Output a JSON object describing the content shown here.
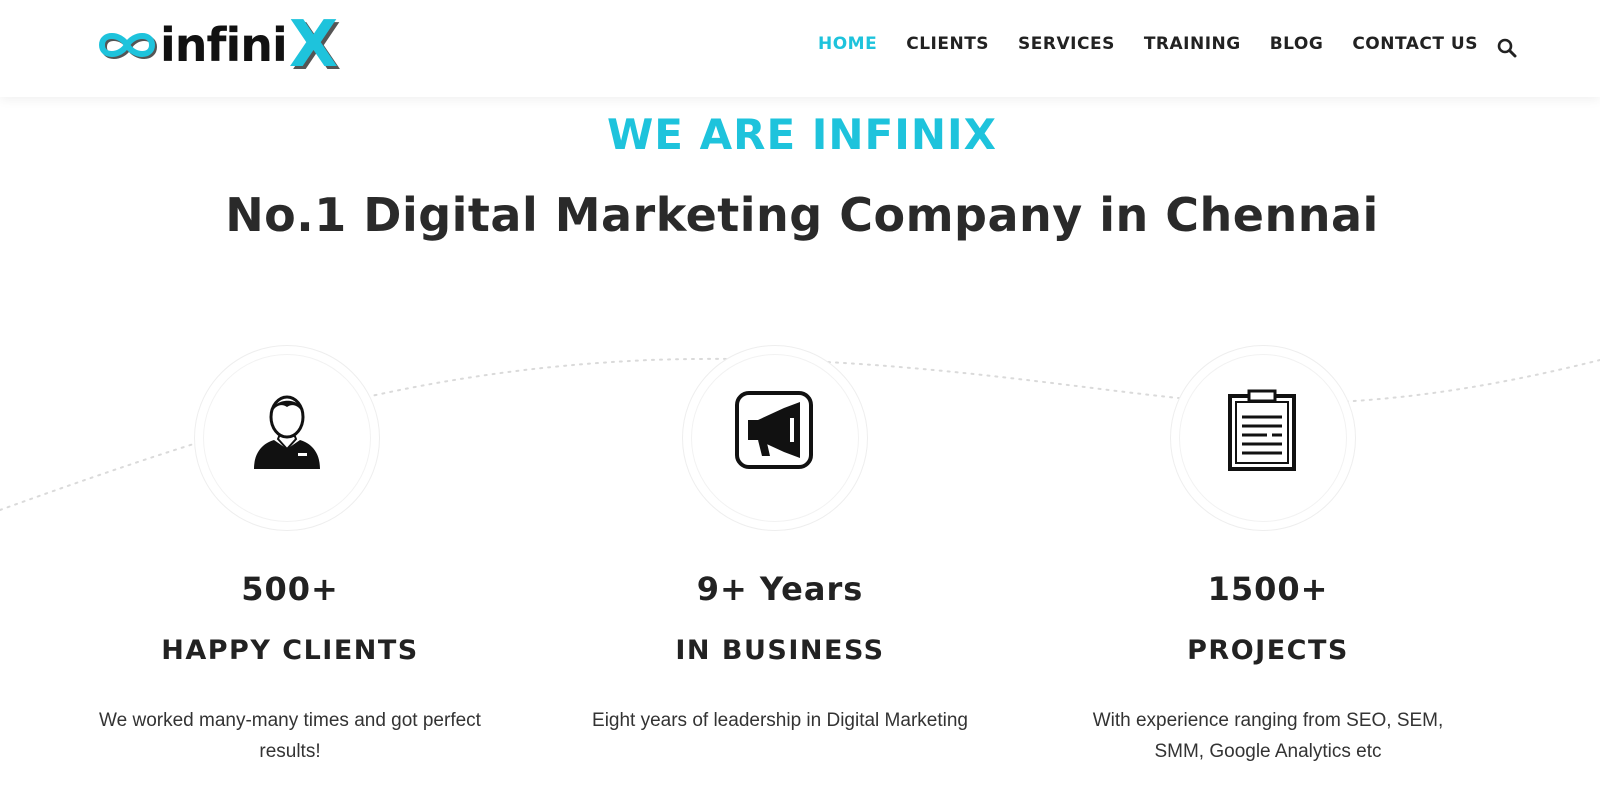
{
  "brand": {
    "logo_text": "infini",
    "logo_x": "X",
    "accent_color": "#1ec3dc"
  },
  "nav": {
    "items": [
      {
        "label": "HOME",
        "active": true
      },
      {
        "label": "CLIENTS"
      },
      {
        "label": "SERVICES"
      },
      {
        "label": "TRAINING"
      },
      {
        "label": "BLOG"
      },
      {
        "label": "CONTACT US"
      }
    ],
    "search_icon": "search-icon"
  },
  "hero": {
    "eyebrow": "WE ARE INFINIX",
    "headline": "No.1 Digital Marketing Company in Chennai"
  },
  "features": [
    {
      "icon": "person-icon",
      "stat": "500+",
      "title": "HAPPY CLIENTS",
      "description": "We worked many-many times and got perfect results!"
    },
    {
      "icon": "megaphone-icon",
      "stat": "9+ Years",
      "title": "IN BUSINESS",
      "description": "Eight years of leadership in Digital Marketing"
    },
    {
      "icon": "clipboard-icon",
      "stat": "1500+",
      "title": "PROJECTS",
      "description": "With experience ranging from SEO, SEM, SMM, Google Analytics etc"
    }
  ]
}
